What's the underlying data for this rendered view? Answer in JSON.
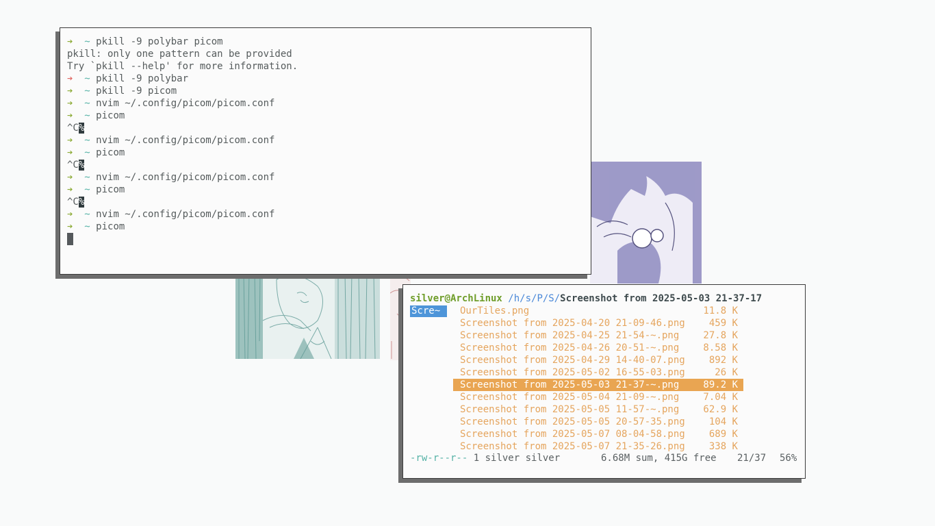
{
  "terminal": {
    "lines": [
      {
        "type": "prompt",
        "status": "ok",
        "cmd": "pkill -9 polybar picom"
      },
      {
        "type": "output",
        "text": "pkill: only one pattern can be provided"
      },
      {
        "type": "output",
        "text": "Try `pkill --help' for more information."
      },
      {
        "type": "prompt",
        "status": "err",
        "cmd": "pkill -9 polybar"
      },
      {
        "type": "prompt",
        "status": "ok",
        "cmd": "pkill -9 picom"
      },
      {
        "type": "prompt",
        "status": "ok",
        "cmd": "nvim ~/.config/picom/picom.conf"
      },
      {
        "type": "prompt",
        "status": "ok",
        "cmd": "picom"
      },
      {
        "type": "interrupt",
        "text": "^C",
        "mark": "%"
      },
      {
        "type": "prompt",
        "status": "ok",
        "cmd": "nvim ~/.config/picom/picom.conf"
      },
      {
        "type": "prompt",
        "status": "ok",
        "cmd": "picom"
      },
      {
        "type": "interrupt",
        "text": "^C",
        "mark": "%"
      },
      {
        "type": "prompt",
        "status": "ok",
        "cmd": "nvim ~/.config/picom/picom.conf"
      },
      {
        "type": "prompt",
        "status": "ok",
        "cmd": "picom"
      },
      {
        "type": "interrupt",
        "text": "^C",
        "mark": "%"
      },
      {
        "type": "prompt",
        "status": "ok",
        "cmd": "nvim ~/.config/picom/picom.conf"
      },
      {
        "type": "prompt",
        "status": "ok",
        "cmd": "picom"
      }
    ],
    "arrow_glyph": "➔",
    "home_glyph": "~",
    "colors": {
      "ok": "#8aa932",
      "err": "#e06560",
      "tilde": "#55b2a6"
    }
  },
  "file_manager": {
    "host": "silver@ArchLinux",
    "path": "/h/s/P/S/",
    "current_file": "Screenshot from 2025-05-03 21-37-17",
    "tab_label": "Scre~",
    "files": [
      {
        "name": "OurTiles.png",
        "size": "11.8 K"
      },
      {
        "name": "Screenshot from 2025-04-20 21-09-46.png",
        "size": "459 K"
      },
      {
        "name": "Screenshot from 2025-04-25 21-54-~.png",
        "size": "27.8 K"
      },
      {
        "name": "Screenshot from 2025-04-26 20-51-~.png",
        "size": "8.58 K"
      },
      {
        "name": "Screenshot from 2025-04-29 14-40-07.png",
        "size": "892 K"
      },
      {
        "name": "Screenshot from 2025-05-02 16-55-03.png",
        "size": "26 K"
      },
      {
        "name": "Screenshot from 2025-05-03 21-37-~.png",
        "size": "89.2 K"
      },
      {
        "name": "Screenshot from 2025-05-04 21-09-~.png",
        "size": "7.04 K"
      },
      {
        "name": "Screenshot from 2025-05-05 11-57-~.png",
        "size": "62.9 K"
      },
      {
        "name": "Screenshot from 2025-05-05 20-57-35.png",
        "size": "104 K"
      },
      {
        "name": "Screenshot from 2025-05-07 08-04-58.png",
        "size": "689 K"
      },
      {
        "name": "Screenshot from 2025-05-07 21-35-26.png",
        "size": "338 K"
      }
    ],
    "selected_index": 6,
    "status": {
      "permissions": "-rw-r--r--",
      "links_owner": "1 silver silver",
      "summary": "6.68M sum, 415G free",
      "position": "21/37",
      "percent": "56%"
    },
    "colors": {
      "file": "#e5a55e",
      "selected_bg": "#e9a552",
      "host": "#6f9d2a",
      "path": "#4a88d8",
      "tab_bg": "#4e95d9"
    }
  }
}
